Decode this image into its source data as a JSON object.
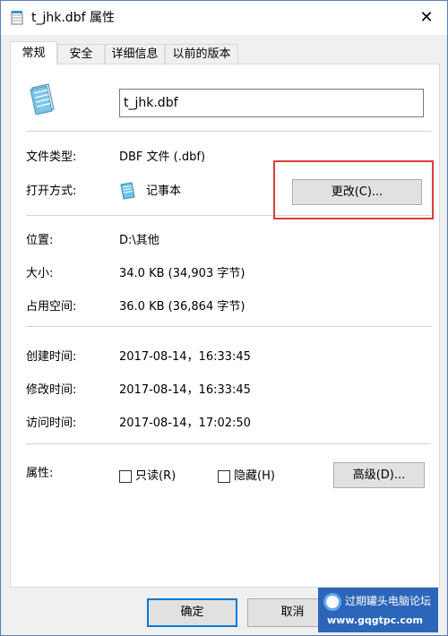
{
  "window": {
    "title": "t_jhk.dbf 属性",
    "close_glyph": "✕"
  },
  "tabs": [
    {
      "label": "常规",
      "active": true
    },
    {
      "label": "安全",
      "active": false
    },
    {
      "label": "详细信息",
      "active": false
    },
    {
      "label": "以前的版本",
      "active": false
    }
  ],
  "general": {
    "file_name": "t_jhk.dbf",
    "file_type_label": "文件类型:",
    "file_type_value": "DBF 文件 (.dbf)",
    "opens_with_label": "打开方式:",
    "opens_with_value": "记事本",
    "change_button": "更改(C)...",
    "location_label": "位置:",
    "location_value": "D:\\其他",
    "size_label": "大小:",
    "size_value": "34.0 KB (34,903 字节)",
    "size_on_disk_label": "占用空间:",
    "size_on_disk_value": "36.0 KB (36,864 字节)",
    "created_label": "创建时间:",
    "created_value": "2017-08-14，16:33:45",
    "modified_label": "修改时间:",
    "modified_value": "2017-08-14，16:33:45",
    "accessed_label": "访问时间:",
    "accessed_value": "2017-08-14，17:02:50",
    "attributes_label": "属性:",
    "readonly_label": "只读(R)",
    "readonly_checked": false,
    "hidden_label": "隐藏(H)",
    "hidden_checked": false,
    "advanced_button": "高级(D)..."
  },
  "footer": {
    "ok_button": "确定",
    "cancel_button": "取消"
  },
  "watermark": {
    "title": "过期罐头电脑论坛",
    "url": "www.gqgtpc.com"
  },
  "colors": {
    "highlight": "#e03a3a",
    "default_button_border": "#0078d7",
    "watermark_bg": "#1c5bb6"
  },
  "icons": {
    "title_icon": "notepad-file-icon",
    "file_icon": "notepad-file-icon",
    "opens_with_icon": "notepad-app-icon"
  }
}
